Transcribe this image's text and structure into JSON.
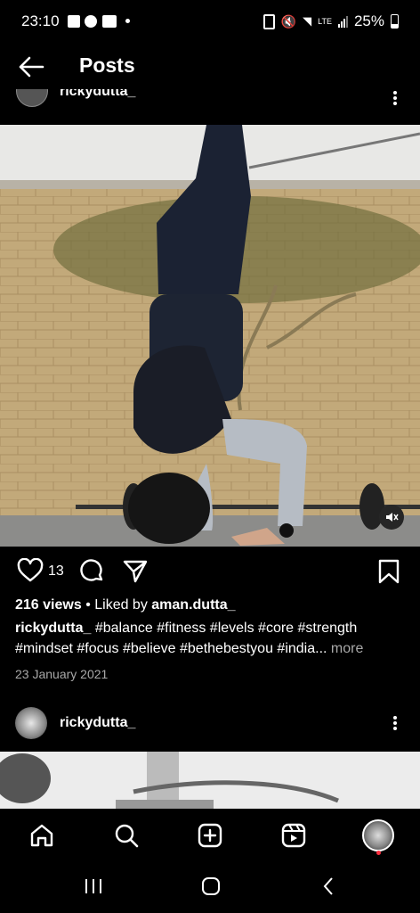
{
  "status_bar": {
    "time": "23:10",
    "battery": "25%",
    "network": "LTE"
  },
  "header": {
    "title": "Posts"
  },
  "prev_post": {
    "username": "rickydutta_"
  },
  "post": {
    "likes_count": "13",
    "views_line": "216 views",
    "liked_by_prefix": "Liked by",
    "liked_by_user": "aman.dutta_",
    "caption_user": "rickydutta_",
    "caption_line1": "#balance #fitness #levels #core #strength",
    "caption_line2": "#mindset #focus #believe #bethebestyou #india...",
    "more_label": "more",
    "date": "23 January 2021"
  },
  "next_post": {
    "username": "rickydutta_"
  },
  "icons": {
    "heart": "heart-icon",
    "comment": "comment-icon",
    "share": "share-icon",
    "save": "bookmark-icon",
    "mute": "mute-icon",
    "home": "home-icon",
    "search": "search-icon",
    "create": "create-icon",
    "reels": "reels-icon",
    "profile": "profile-avatar"
  }
}
